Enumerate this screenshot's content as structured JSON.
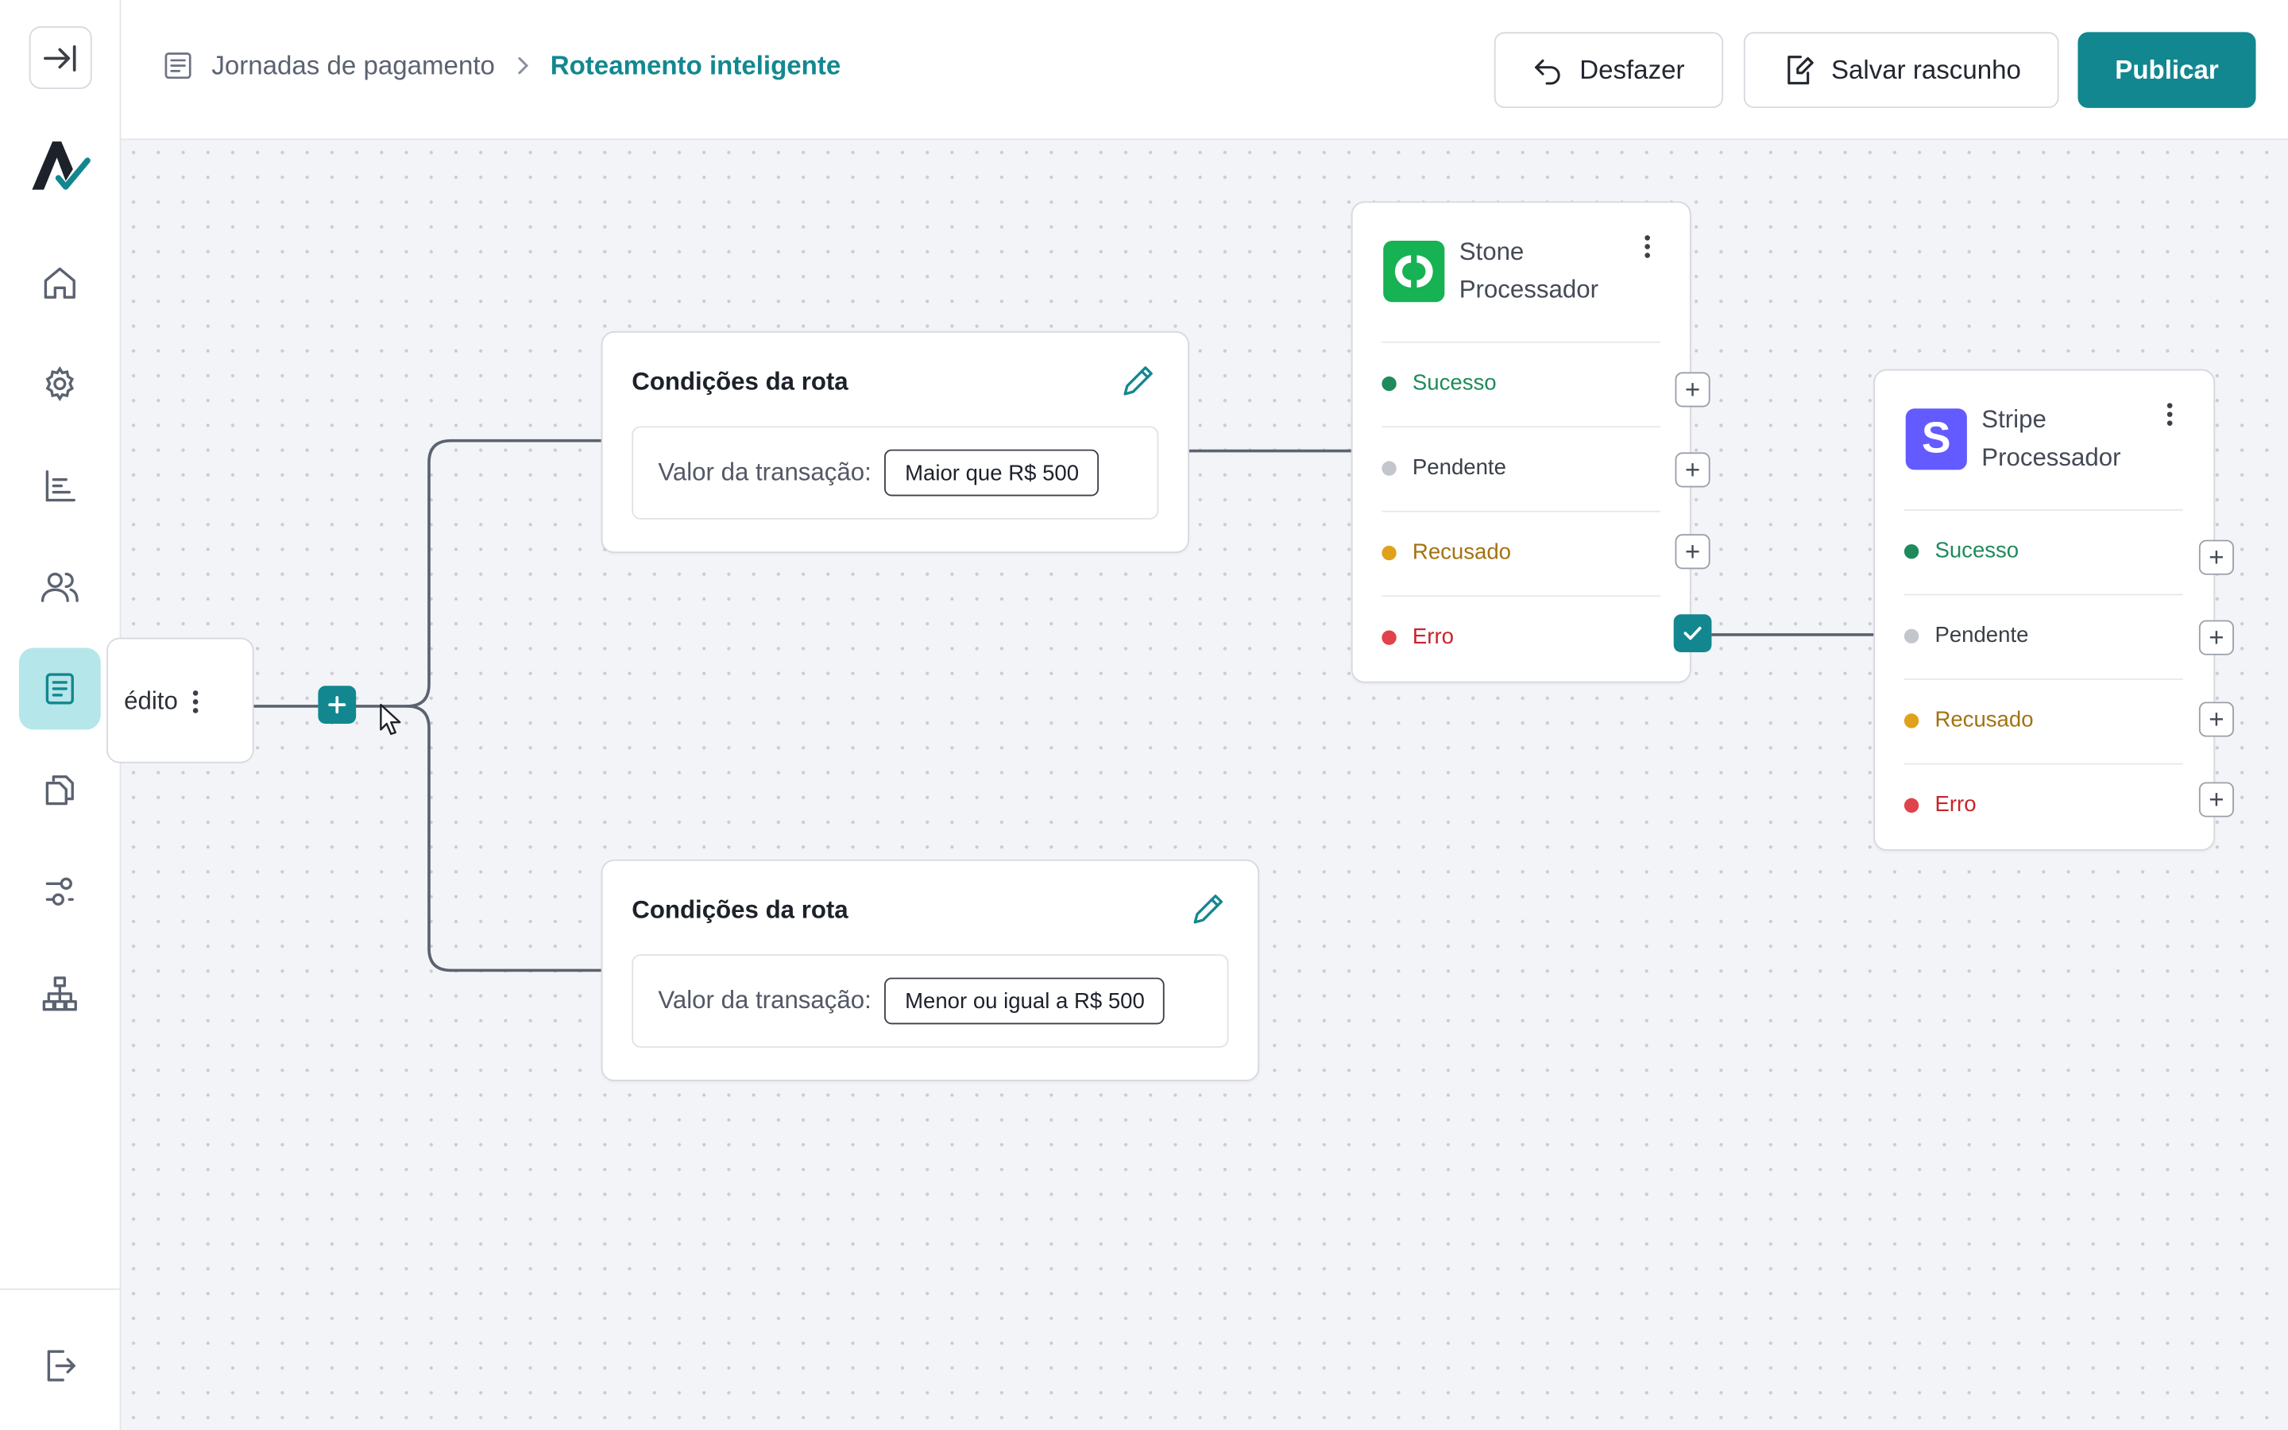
{
  "sidebar": {
    "items": [
      {
        "name": "home",
        "icon": "home-icon"
      },
      {
        "name": "settings",
        "icon": "gear-icon"
      },
      {
        "name": "reports",
        "icon": "bar-chart-icon"
      },
      {
        "name": "users",
        "icon": "users-icon"
      },
      {
        "name": "journeys",
        "icon": "document-icon",
        "active": true
      },
      {
        "name": "files",
        "icon": "copy-icon"
      },
      {
        "name": "filters",
        "icon": "sliders-icon"
      },
      {
        "name": "hierarchy",
        "icon": "org-chart-icon"
      }
    ],
    "logout_icon": "logout-icon",
    "collapse_icon": "collapse-icon"
  },
  "header": {
    "breadcrumb": {
      "parent": "Jornadas de pagamento",
      "current": "Roteamento inteligente"
    },
    "undo_label": "Desfazer",
    "save_draft_label": "Salvar rascunho",
    "publish_label": "Publicar"
  },
  "canvas": {
    "source_node": {
      "label": "édito"
    },
    "conditions": [
      {
        "title": "Condições da rota",
        "field_label": "Valor da transação:",
        "value": "Maior que R$ 500"
      },
      {
        "title": "Condições da rota",
        "field_label": "Valor da transação:",
        "value": "Menor ou igual a R$ 500"
      }
    ],
    "processors": [
      {
        "name": "Stone",
        "subtitle": "Processador",
        "logo_color": "#17b253",
        "statuses": [
          {
            "label": "Sucesso",
            "color": "#1f8a5b"
          },
          {
            "label": "Pendente",
            "color": "#c3c6cd"
          },
          {
            "label": "Recusado",
            "color": "#e0a11c"
          },
          {
            "label": "Erro",
            "color": "#e0434b"
          }
        ]
      },
      {
        "name": "Stripe",
        "subtitle": "Processador",
        "logo_color": "#635bff",
        "logo_letter": "S",
        "statuses": [
          {
            "label": "Sucesso",
            "color": "#1f8a5b"
          },
          {
            "label": "Pendente",
            "color": "#c3c6cd"
          },
          {
            "label": "Recusado",
            "color": "#e0a11c"
          },
          {
            "label": "Erro",
            "color": "#e0434b"
          }
        ]
      }
    ]
  },
  "colors": {
    "accent": "#128790",
    "sidebar_active": "#b5e6ea"
  }
}
